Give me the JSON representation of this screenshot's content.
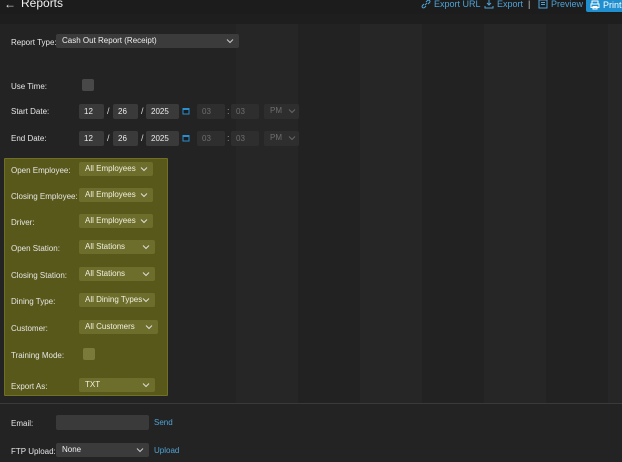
{
  "header": {
    "back_icon": "arrow-left-icon",
    "title": "Reports",
    "export_url": "Export URL",
    "export": "Export",
    "separator": "|",
    "preview": "Preview",
    "print": "Print",
    "accent": "#1f8fd0"
  },
  "form": {
    "report_type_label": "Report Type:",
    "report_type_value": "Cash Out Report (Receipt)",
    "use_time_label": "Use Time:",
    "start_date": {
      "label": "Start Date:",
      "month": "12",
      "day": "26",
      "year": "2025",
      "hour": "03",
      "minute": "03",
      "ampm": "PM"
    },
    "end_date": {
      "label": "End Date:",
      "month": "12",
      "day": "26",
      "year": "2025",
      "hour": "03",
      "minute": "03",
      "ampm": "PM"
    },
    "date_sep": "/",
    "time_sep": ":"
  },
  "filters": {
    "highlight_color": "#58581a",
    "open_employee": {
      "label": "Open Employee:",
      "value": "All Employees"
    },
    "closing_employee": {
      "label": "Closing Employee:",
      "value": "All Employees"
    },
    "driver": {
      "label": "Driver:",
      "value": "All Employees"
    },
    "open_station": {
      "label": "Open Station:",
      "value": "All Stations"
    },
    "closing_station": {
      "label": "Closing Station:",
      "value": "All Stations"
    },
    "dining_type": {
      "label": "Dining Type:",
      "value": "All Dining Types"
    },
    "customer": {
      "label": "Customer:",
      "value": "All Customers"
    },
    "training_mode": {
      "label": "Training Mode:"
    },
    "export_as": {
      "label": "Export As:",
      "value": "TXT"
    }
  },
  "delivery": {
    "email_label": "Email:",
    "email_value": "",
    "send": "Send",
    "ftp_label": "FTP Upload:",
    "ftp_value": "None",
    "upload": "Upload"
  }
}
